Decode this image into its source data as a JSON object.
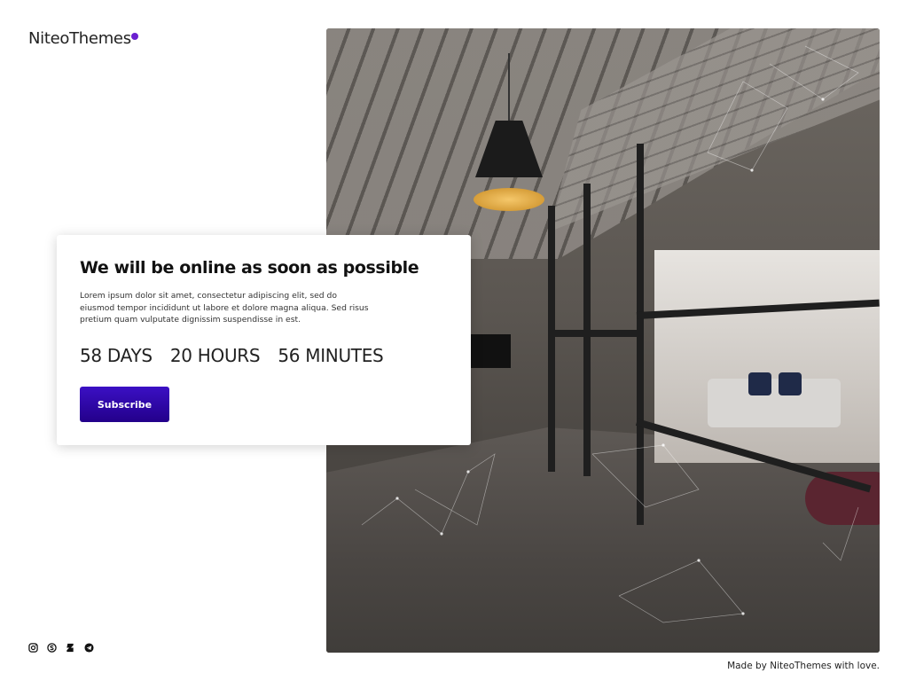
{
  "brand": {
    "name": "NiteoThemes",
    "dot_color": "#6a1fd0"
  },
  "hero": {
    "title": "We will be online as soon as possible",
    "description": "Lorem ipsum dolor sit amet, consectetur adipiscing elit, sed do eiusmod tempor incididunt ut labore et dolore magna aliqua. Sed risus pretium quam vulputate dignissim suspendisse in est.",
    "countdown": {
      "days": "58 DAYS",
      "hours": "20 HOURS",
      "minutes": "56 MINUTES"
    },
    "subscribe_label": "Subscribe",
    "accent_color": "#2a0aa6"
  },
  "social": [
    {
      "name": "instagram-icon"
    },
    {
      "name": "skype-icon"
    },
    {
      "name": "deviantart-icon"
    },
    {
      "name": "telegram-icon"
    }
  ],
  "footer": {
    "credit": "Made by NiteoThemes with love."
  }
}
